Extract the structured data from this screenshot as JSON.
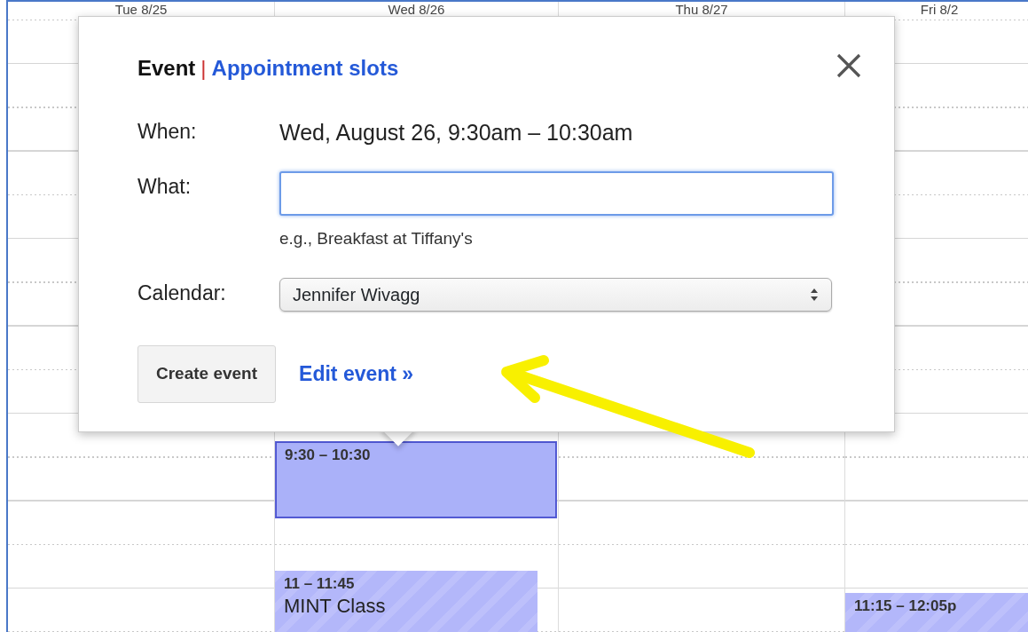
{
  "columns": [
    {
      "header": "Tue 8/25"
    },
    {
      "header": "Wed 8/26",
      "events": [
        {
          "kind": "draft",
          "time": "9:30 – 10:30",
          "selected": true
        },
        {
          "kind": "hatched",
          "time": "11 – 11:45",
          "title": "MINT Class",
          "selected": false
        }
      ]
    },
    {
      "header": "Thu 8/27"
    },
    {
      "header": "Fri 8/2",
      "events": [
        {
          "kind": "hatched",
          "time": "11:15 – 12:05p",
          "selected": false
        }
      ]
    }
  ],
  "popup": {
    "tabs": [
      {
        "label": "Event",
        "selected": true
      },
      {
        "label": "Appointment slots",
        "selected": false
      }
    ],
    "separator": "|",
    "fields": [
      {
        "kind": "text",
        "label": "When:",
        "value": "Wed, August 26, 9:30am – 10:30am"
      },
      {
        "kind": "input",
        "label": "What:",
        "hint": "e.g., Breakfast at Tiffany's",
        "focused": true
      },
      {
        "kind": "select",
        "label": "Calendar:",
        "value": "Jennifer Wivagg"
      }
    ],
    "create_button": "Create event",
    "edit_link": "Edit event »"
  }
}
